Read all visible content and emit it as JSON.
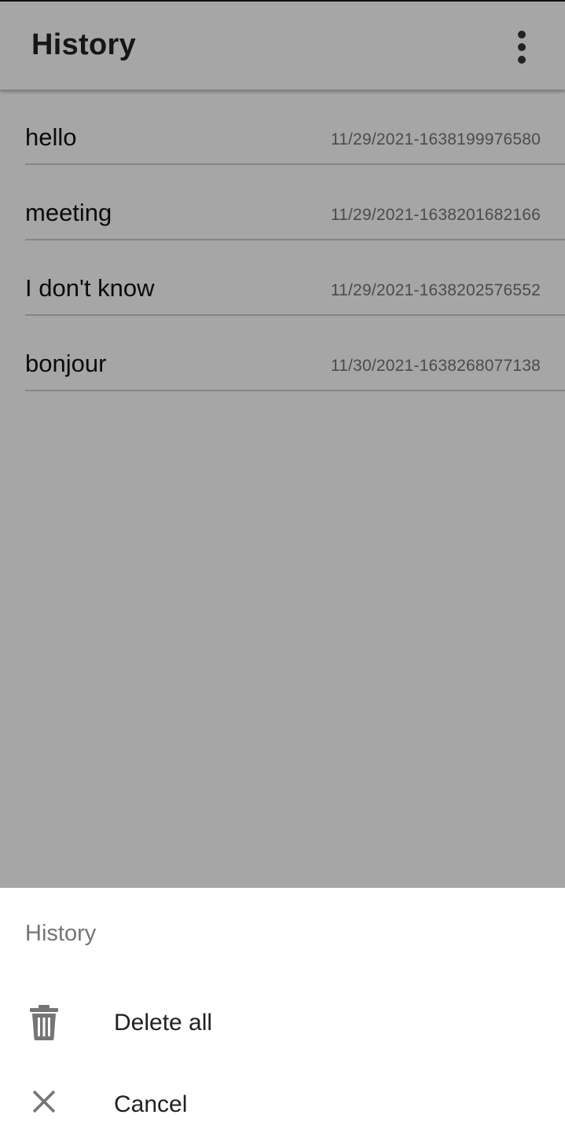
{
  "app_bar": {
    "title": "History",
    "overflow_icon": "more-vert-icon"
  },
  "history": {
    "items": [
      {
        "text": "hello",
        "time": "11/29/2021-1638199976580"
      },
      {
        "text": "meeting",
        "time": "11/29/2021-1638201682166"
      },
      {
        "text": "I don't know",
        "time": "11/29/2021-1638202576552"
      },
      {
        "text": "bonjour",
        "time": "11/30/2021-1638268077138"
      }
    ]
  },
  "bottom_sheet": {
    "title": "History",
    "actions": [
      {
        "label": "Delete all",
        "icon": "trash-icon"
      },
      {
        "label": "Cancel",
        "icon": "close-icon"
      }
    ]
  },
  "colors": {
    "background": "#f5f5f5",
    "scrim": "rgba(0,0,0,0.32)",
    "sheet": "#ffffff"
  }
}
